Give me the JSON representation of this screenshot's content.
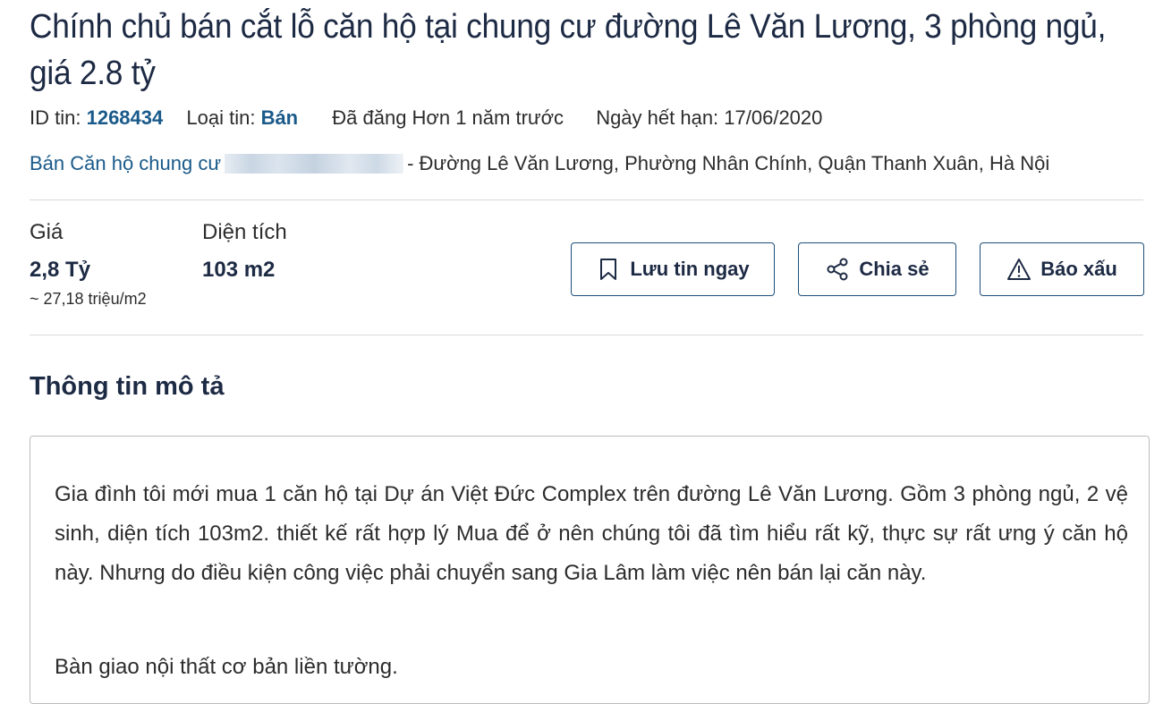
{
  "listing": {
    "title": "Chính chủ bán cắt lỗ căn hộ tại chung cư đường Lê Văn Lương, 3 phòng ngủ, giá 2.8 tỷ",
    "meta": {
      "id_label": "ID tin:",
      "id_value": "1268434",
      "type_label": "Loại tin:",
      "type_value": "Bán",
      "posted": "Đã đăng Hơn 1 năm trước",
      "expiry": "Ngày hết hạn: 17/06/2020"
    },
    "location": {
      "link_text": "Bán Căn hộ chung cư",
      "rest": "- Đường Lê Văn Lương, Phường Nhân Chính, Quận Thanh Xuân, Hà Nội"
    },
    "stats": {
      "price_label": "Giá",
      "price_value": "2,8 Tỷ",
      "price_per_m2": "~ 27,18 triệu/m2",
      "area_label": "Diện tích",
      "area_value": "103 m2"
    },
    "actions": {
      "save_label": "Lưu tin ngay",
      "share_label": "Chia sẻ",
      "report_label": "Báo xấu"
    },
    "description": {
      "heading": "Thông tin mô tả",
      "paragraph1": "Gia đình tôi mới mua 1 căn hộ tại Dự án Việt Đức Complex trên đường Lê Văn Lương. Gồm 3 phòng ngủ, 2 vệ sinh, diện tích 103m2. thiết kế rất hợp lý Mua để ở nên chúng tôi đã tìm hiểu rất kỹ, thực sự rất ưng ý căn hộ này. Nhưng do điều kiện công việc phải chuyển sang Gia Lâm làm việc nên bán lại căn này.",
      "paragraph2": "Bàn giao nội thất cơ bản liền tường."
    }
  },
  "icons": {
    "save": "bookmark-icon",
    "share": "share-icon",
    "report": "warning-icon"
  },
  "colors": {
    "link": "#1a5a8a",
    "title": "#1d2a44",
    "button_border": "#1d4f7a"
  }
}
